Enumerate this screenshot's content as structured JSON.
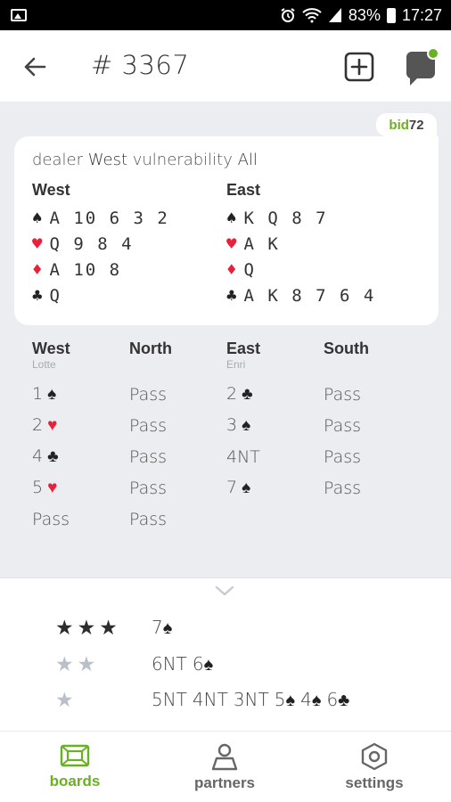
{
  "status_bar": {
    "battery": "83%",
    "time": "17:27",
    "icons": [
      "image-icon",
      "alarm-icon",
      "wifi-icon",
      "signal-icon",
      "battery-icon"
    ]
  },
  "header": {
    "title": "# 3367",
    "back_icon": "arrow-left-icon",
    "add_icon": "plus-square-icon",
    "chat_icon": "chat-bubble-icon"
  },
  "brand": {
    "part1": "bid",
    "part2": "72",
    "accent": "#6ab023"
  },
  "deal": {
    "dealer_label": "dealer",
    "dealer": "West",
    "vuln_label": "vulnerability",
    "vulnerability": "All",
    "west": {
      "name": "West",
      "spades": "A 10 6 3 2",
      "hearts": "Q 9 8 4",
      "diamonds": "A 10 8",
      "clubs": "Q"
    },
    "east": {
      "name": "East",
      "spades": "K Q 8 7",
      "hearts": "A K",
      "diamonds": "Q",
      "clubs": "A K 8 7 6 4"
    }
  },
  "auction": {
    "players": [
      {
        "name": "West",
        "partner": "Lotte"
      },
      {
        "name": "North",
        "partner": ""
      },
      {
        "name": "East",
        "partner": "Enri"
      },
      {
        "name": "South",
        "partner": ""
      }
    ],
    "rows": [
      [
        {
          "level": "1",
          "suit": "♠",
          "color": "black"
        },
        {
          "text": "Pass"
        },
        {
          "level": "2",
          "suit": "♣",
          "color": "black"
        },
        {
          "text": "Pass"
        }
      ],
      [
        {
          "level": "2",
          "suit": "♥",
          "color": "red"
        },
        {
          "text": "Pass"
        },
        {
          "level": "3",
          "suit": "♠",
          "color": "black"
        },
        {
          "text": "Pass"
        }
      ],
      [
        {
          "level": "4",
          "suit": "♣",
          "color": "black"
        },
        {
          "text": "Pass"
        },
        {
          "text": "4NT"
        },
        {
          "text": "Pass"
        }
      ],
      [
        {
          "level": "5",
          "suit": "♥",
          "color": "red"
        },
        {
          "text": "Pass"
        },
        {
          "level": "7",
          "suit": "♠",
          "color": "black"
        },
        {
          "text": "Pass"
        }
      ],
      [
        {
          "text": "Pass"
        },
        {
          "text": "Pass"
        },
        null,
        null
      ]
    ]
  },
  "ratings": [
    {
      "stars": 3,
      "contracts": [
        {
          "level": "7",
          "suit": "♠",
          "color": "black"
        }
      ]
    },
    {
      "stars": 2,
      "contracts": [
        {
          "text": "6NT"
        },
        {
          "level": "6",
          "suit": "♠",
          "color": "black"
        }
      ]
    },
    {
      "stars": 1,
      "contracts": [
        {
          "text": "5NT"
        },
        {
          "text": "4NT"
        },
        {
          "text": "3NT"
        },
        {
          "level": "5",
          "suit": "♠",
          "color": "black"
        },
        {
          "level": "4",
          "suit": "♠",
          "color": "black"
        },
        {
          "level": "6",
          "suit": "♣",
          "color": "black"
        }
      ]
    }
  ],
  "nav": {
    "boards": "boards",
    "partners": "partners",
    "settings": "settings"
  },
  "colors": {
    "accent": "#6ab023",
    "red_suit": "#e8213a",
    "background": "#ebedf0"
  }
}
